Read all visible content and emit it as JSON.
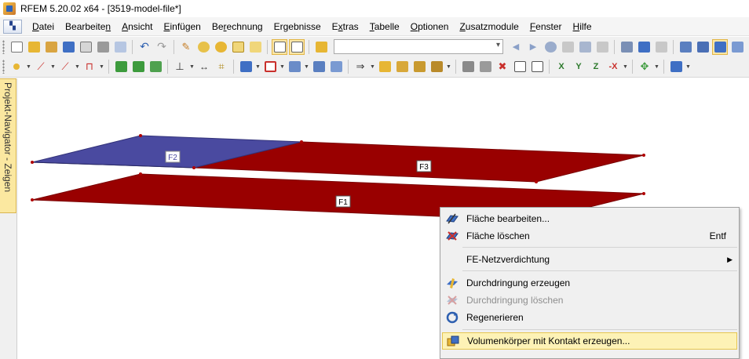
{
  "window": {
    "title": "RFEM 5.20.02 x64 - [3519-model-file*]"
  },
  "menu": {
    "items": [
      {
        "u": "D",
        "rest": "atei"
      },
      {
        "u": "",
        "pre": "Bearbeite",
        "u2": "n"
      },
      {
        "u": "A",
        "rest": "nsicht"
      },
      {
        "u": "E",
        "rest": "infügen"
      },
      {
        "u": "",
        "pre": "Be",
        "u2": "r",
        "post": "echnung"
      },
      {
        "u": "",
        "pre": "Er",
        "u2": "g",
        "post": "ebnisse"
      },
      {
        "u": "",
        "pre": "E",
        "u2": "x",
        "post": "tras"
      },
      {
        "u": "T",
        "rest": "abelle"
      },
      {
        "u": "O",
        "rest": "ptionen"
      },
      {
        "u": "Z",
        "rest": "usatzmodule"
      },
      {
        "u": "F",
        "rest": "enster"
      },
      {
        "u": "H",
        "rest": "ilfe"
      }
    ]
  },
  "toolbar": {
    "combo_value": "",
    "colors": {
      "blue": "#3f6fc4",
      "yellow": "#e7b634",
      "red": "#c9302c",
      "green": "#3d9b3d",
      "gray": "#8a8a8a"
    }
  },
  "navigator": {
    "label": "Projekt-Navigator - Zeigen"
  },
  "model": {
    "surfaces": [
      {
        "id": "F2",
        "color": "#4a4aa0"
      },
      {
        "id": "F3",
        "color": "#990000"
      },
      {
        "id": "F1",
        "color": "#990000"
      }
    ]
  },
  "context_menu": {
    "items": [
      {
        "label": "Fläche bearbeiten...",
        "shortcut": "",
        "icon": "edit-surface-icon",
        "disabled": false
      },
      {
        "label": "Fläche löschen",
        "shortcut": "Entf",
        "icon": "delete-surface-icon",
        "disabled": false
      },
      {
        "label": "FE-Netzverdichtung",
        "shortcut": "",
        "icon": "",
        "disabled": false,
        "submenu": true
      },
      {
        "label": "Durchdringung erzeugen",
        "shortcut": "",
        "icon": "create-intersection-icon",
        "disabled": false
      },
      {
        "label": "Durchdringung löschen",
        "shortcut": "",
        "icon": "delete-intersection-icon",
        "disabled": true
      },
      {
        "label": "Regenerieren",
        "shortcut": "",
        "icon": "regenerate-icon",
        "disabled": false
      },
      {
        "label": "Volumenkörper mit Kontakt erzeugen...",
        "shortcut": "",
        "icon": "create-solid-contact-icon",
        "disabled": false
      }
    ]
  }
}
